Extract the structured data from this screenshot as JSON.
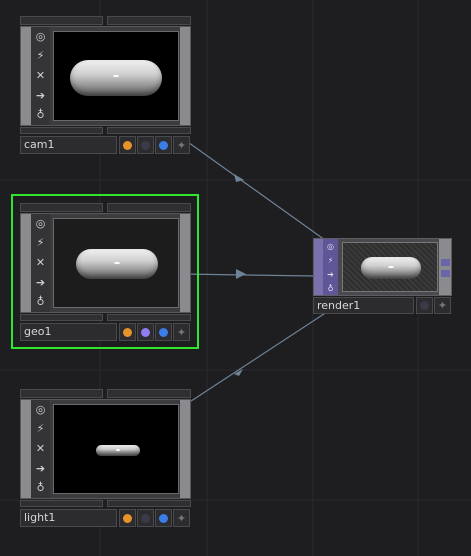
{
  "nodes": {
    "cam1": {
      "name": "cam1"
    },
    "geo1": {
      "name": "geo1"
    },
    "light1": {
      "name": "light1"
    },
    "render1": {
      "name": "render1"
    }
  },
  "icons": {
    "side": [
      "viewer-active-icon",
      "bypass-icon",
      "lock-icon",
      "export-icon",
      "clone-icon"
    ],
    "flags": [
      "cook-flag-icon",
      "render-flag-icon",
      "display-flag-icon",
      "pickable-star-icon"
    ]
  },
  "colors": {
    "background": "#1e1e21",
    "selection": "#2ee62e",
    "wire": "#6f8397",
    "render_flag_on": "#8f7ef0",
    "cook_flag": "#e6932a",
    "display_flag": "#3b7de6",
    "off_flag": "#3a3a48"
  }
}
